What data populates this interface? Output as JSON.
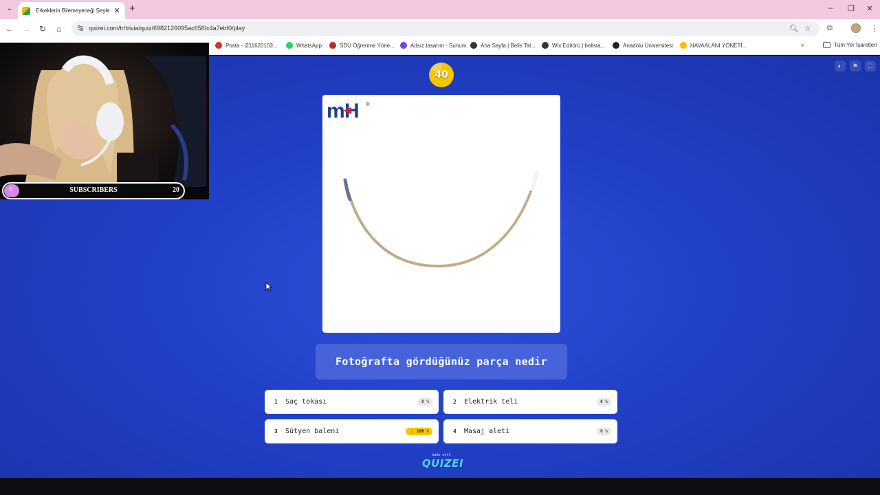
{
  "browser": {
    "tab_title": "Erkeklerin Bilemeyeceği Şeyler",
    "url": "quizei.com/tr/trivia/quiz/6982126095ac65f0c4a7ebf0/play",
    "bookmarks": [
      {
        "label": "Posta - l211620103...",
        "icon": "mail-icon",
        "color": "#d93025"
      },
      {
        "label": "WhatsApp",
        "icon": "whatsapp-icon",
        "color": "#25d366"
      },
      {
        "label": "SDÜ Öğrenme Yöne...",
        "icon": "sdu-icon",
        "color": "#c62828"
      },
      {
        "label": "Adsız tasarım - Sunum",
        "icon": "canva-icon",
        "color": "#7b3fe4"
      },
      {
        "label": "Ana Sayfa | Bells Tal...",
        "icon": "wix-icon",
        "color": "#333333"
      },
      {
        "label": "Wix Editörü | bellsta...",
        "icon": "wix-icon",
        "color": "#333333"
      },
      {
        "label": "Anadolu Üniversitesi",
        "icon": "anadolu-icon",
        "color": "#222222"
      },
      {
        "label": "HAVAALANI YÖNETİ...",
        "icon": "drive-icon",
        "color": "#fbbc04"
      }
    ],
    "all_bookmarks_label": "Tüm Yer İşaretleri",
    "more_bookmarks": "»"
  },
  "quiz": {
    "timer": "40",
    "timer_fraction": 0.83,
    "question": "Fotoğrafta gördüğünüz parça nedir",
    "brand_logo": "mH",
    "answers": [
      {
        "num": "1",
        "text": "Saç tokası",
        "pct": "0 %",
        "correct": false
      },
      {
        "num": "2",
        "text": "Elektrik teli",
        "pct": "0 %",
        "correct": false
      },
      {
        "num": "3",
        "text": "Sütyen baleni",
        "pct": "👍 100 %",
        "correct": true
      },
      {
        "num": "4",
        "text": "Masaj aleti",
        "pct": "0 %",
        "correct": false
      }
    ],
    "made_with": "made with",
    "made_logo": "QUIZEI"
  },
  "overlay": {
    "sub_count": "0",
    "sub_label": "SUBSCRIBERS",
    "sub_goal": "20"
  },
  "colors": {
    "page_blue": "#2040c7",
    "timer_yellow": "#f6c600",
    "correct_badge": "#f4c800",
    "tab_bar_pink": "#f4c8df"
  }
}
